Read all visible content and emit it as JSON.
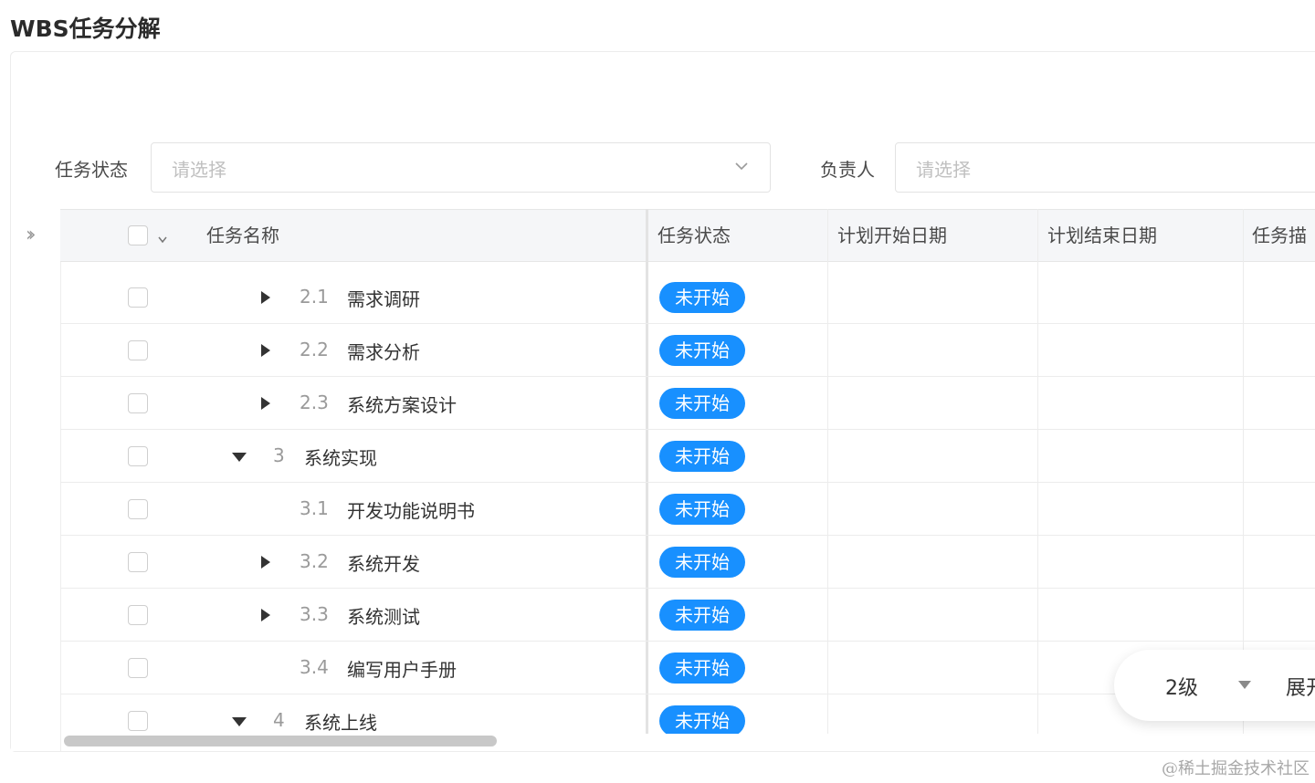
{
  "page": {
    "title": "WBS任务分解"
  },
  "filters": {
    "status": {
      "label": "任务状态",
      "placeholder": "请选择"
    },
    "owner": {
      "label": "负责人",
      "placeholder": "请选择"
    }
  },
  "table": {
    "columns": [
      "任务名称",
      "任务状态",
      "计划开始日期",
      "计划结束日期",
      "任务描"
    ],
    "rows": [
      {
        "num": "2.1",
        "name": "需求调研",
        "status": "未开始",
        "toggle": "collapsed",
        "level": 2
      },
      {
        "num": "2.2",
        "name": "需求分析",
        "status": "未开始",
        "toggle": "collapsed",
        "level": 2
      },
      {
        "num": "2.3",
        "name": "系统方案设计",
        "status": "未开始",
        "toggle": "collapsed",
        "level": 2
      },
      {
        "num": "3",
        "name": "系统实现",
        "status": "未开始",
        "toggle": "expanded",
        "level": 1
      },
      {
        "num": "3.1",
        "name": "开发功能说明书",
        "status": "未开始",
        "toggle": "none",
        "level": 2
      },
      {
        "num": "3.2",
        "name": "系统开发",
        "status": "未开始",
        "toggle": "collapsed",
        "level": 2
      },
      {
        "num": "3.3",
        "name": "系统测试",
        "status": "未开始",
        "toggle": "collapsed",
        "level": 2
      },
      {
        "num": "3.4",
        "name": "编写用户手册",
        "status": "未开始",
        "toggle": "none",
        "level": 2
      },
      {
        "num": "4",
        "name": "系统上线",
        "status": "未开始",
        "toggle": "expanded",
        "level": 1
      }
    ]
  },
  "level_control": {
    "level": "2级",
    "action": "展开"
  },
  "watermark": "@稀土掘金技术社区",
  "colors": {
    "status_tag": "#1890ff",
    "header_bg": "#f5f6f8"
  }
}
